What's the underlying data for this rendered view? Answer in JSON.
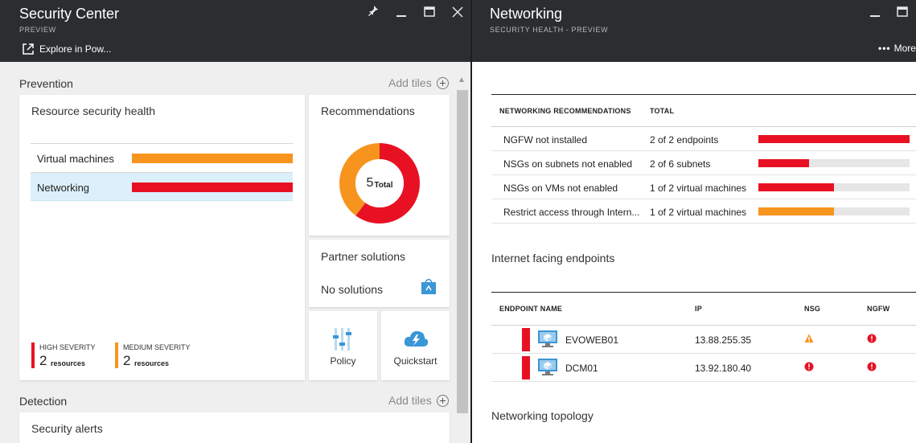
{
  "colors": {
    "high": "#e81123",
    "medium": "#f7941d",
    "header": "#2b2d30",
    "selected_row": "#dcf0fb"
  },
  "security_center": {
    "title": "Security Center",
    "subtitle": "PREVIEW",
    "controls": [
      "pin-icon",
      "minimize-icon",
      "maximize-icon",
      "close-icon"
    ],
    "command": {
      "icon": "external-link-icon",
      "label": "Explore in Pow..."
    },
    "prevention": {
      "label": "Prevention",
      "add_tiles": "Add tiles",
      "resource_health": {
        "title": "Resource security health",
        "rows": [
          {
            "label": "Virtual machines",
            "severity": "medium"
          },
          {
            "label": "Networking",
            "severity": "high",
            "selected": true
          }
        ],
        "high": {
          "label": "HIGH SEVERITY",
          "count": "2",
          "unit": "resources"
        },
        "medium": {
          "label": "MEDIUM SEVERITY",
          "count": "2",
          "unit": "resources"
        }
      },
      "recommendations": {
        "title": "Recommendations",
        "total_number": "5",
        "total_label": "Total",
        "segments": [
          {
            "severity": "high",
            "value": 3
          },
          {
            "severity": "medium",
            "value": 2
          }
        ]
      },
      "partner": {
        "title": "Partner solutions",
        "status": "No solutions",
        "icon": "shopping-bag-icon"
      },
      "policy": {
        "label": "Policy",
        "icon": "sliders-icon"
      },
      "quickstart": {
        "label": "Quickstart",
        "icon": "cloud-lightning-icon"
      }
    },
    "detection": {
      "label": "Detection",
      "add_tiles": "Add tiles",
      "alerts_title": "Security alerts"
    }
  },
  "networking": {
    "title": "Networking",
    "subtitle": "SECURITY HEALTH - PREVIEW",
    "controls": [
      "minimize-icon",
      "maximize-icon"
    ],
    "more_label": "More",
    "recommendations_table": {
      "headers": [
        "NETWORKING RECOMMENDATIONS",
        "TOTAL"
      ],
      "rows": [
        {
          "name": "NGFW not installed",
          "total": "2 of 2 endpoints",
          "fraction": 1.0,
          "severity": "high"
        },
        {
          "name": "NSGs on subnets not enabled",
          "total": "2 of 6 subnets",
          "fraction": 0.333,
          "severity": "high"
        },
        {
          "name": "NSGs on VMs not enabled",
          "total": "1 of 2 virtual machines",
          "fraction": 0.5,
          "severity": "high"
        },
        {
          "name": "Restrict access through Intern...",
          "total": "1 of 2 virtual machines",
          "fraction": 0.5,
          "severity": "medium"
        }
      ]
    },
    "internet_facing": {
      "title": "Internet facing endpoints",
      "headers": [
        "ENDPOINT NAME",
        "IP",
        "NSG",
        "NGFW"
      ],
      "rows": [
        {
          "name": "EVOWEB01",
          "ip": "13.88.255.35",
          "nsg": "warning",
          "ngfw": "error"
        },
        {
          "name": "DCM01",
          "ip": "13.92.180.40",
          "nsg": "error",
          "ngfw": "error"
        }
      ]
    },
    "topology_title": "Networking topology"
  }
}
